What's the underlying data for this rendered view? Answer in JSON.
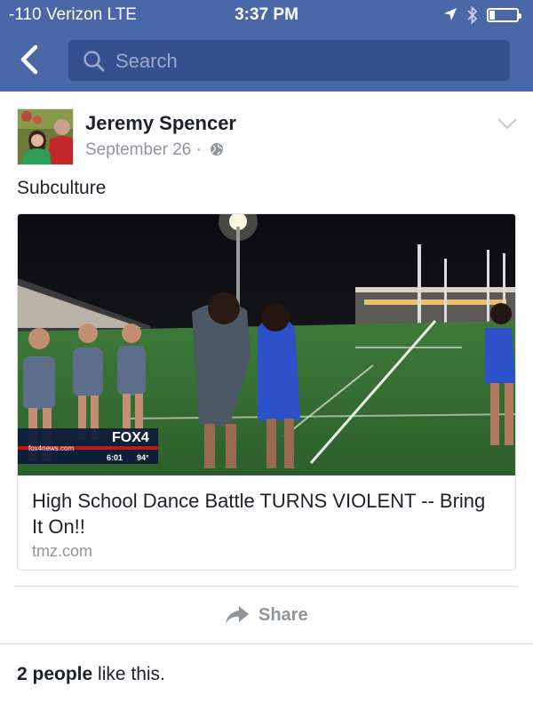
{
  "status_bar": {
    "carrier": "-110 Verizon  LTE",
    "time": "3:37 PM",
    "icons": [
      "location-arrow-icon",
      "bluetooth-icon",
      "battery-icon"
    ],
    "battery_level": 0.2
  },
  "nav": {
    "back_icon": "chevron-left-icon",
    "search_placeholder": "Search"
  },
  "post": {
    "author": "Jeremy Spencer",
    "date": "September 26 ·",
    "privacy_icon": "globe-icon",
    "text": "Subculture",
    "link": {
      "title": "High School Dance Battle TURNS VIOLENT -- Bring It On!!",
      "domain": "tmz.com",
      "thumbnail_overlay": {
        "station": "FOX4",
        "site": "fox4news.com",
        "time": "6:01",
        "temp": "94°"
      }
    },
    "actions": {
      "share_label": "Share"
    },
    "likes": {
      "count_text": "2 people",
      "suffix": " like this."
    }
  },
  "colors": {
    "header": "#4a67a8",
    "search_field": "#35508c",
    "meta_text": "#90949c"
  }
}
